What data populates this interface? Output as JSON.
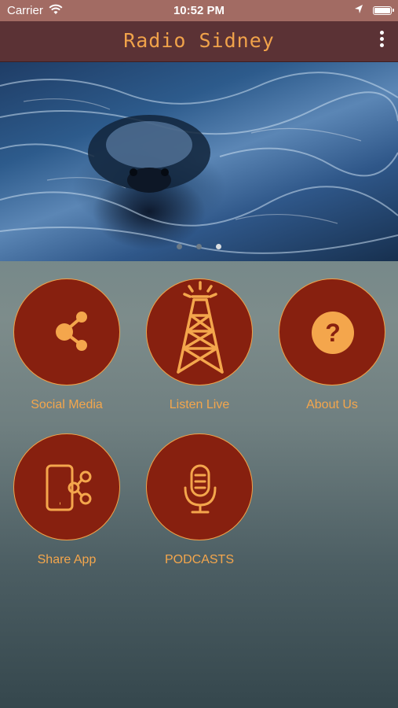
{
  "status_bar": {
    "carrier": "Carrier",
    "time": "10:52 PM"
  },
  "nav": {
    "title": "Radio Sidney",
    "menu_icon": "more-vertical-icon"
  },
  "carousel": {
    "page_count": 3,
    "active_index": 2
  },
  "tiles": [
    {
      "label": "Social Media",
      "icon": "share-icon"
    },
    {
      "label": "Listen Live",
      "icon": "radio-tower-icon"
    },
    {
      "label": "About Us",
      "icon": "help-icon"
    },
    {
      "label": "Share App",
      "icon": "share-app-icon"
    },
    {
      "label": "PODCASTS",
      "icon": "microphone-icon"
    }
  ],
  "colors": {
    "accent": "#f0a24a",
    "tile_fill": "#87200f",
    "nav_bg": "#5b3235",
    "status_bg": "#a26b63"
  }
}
